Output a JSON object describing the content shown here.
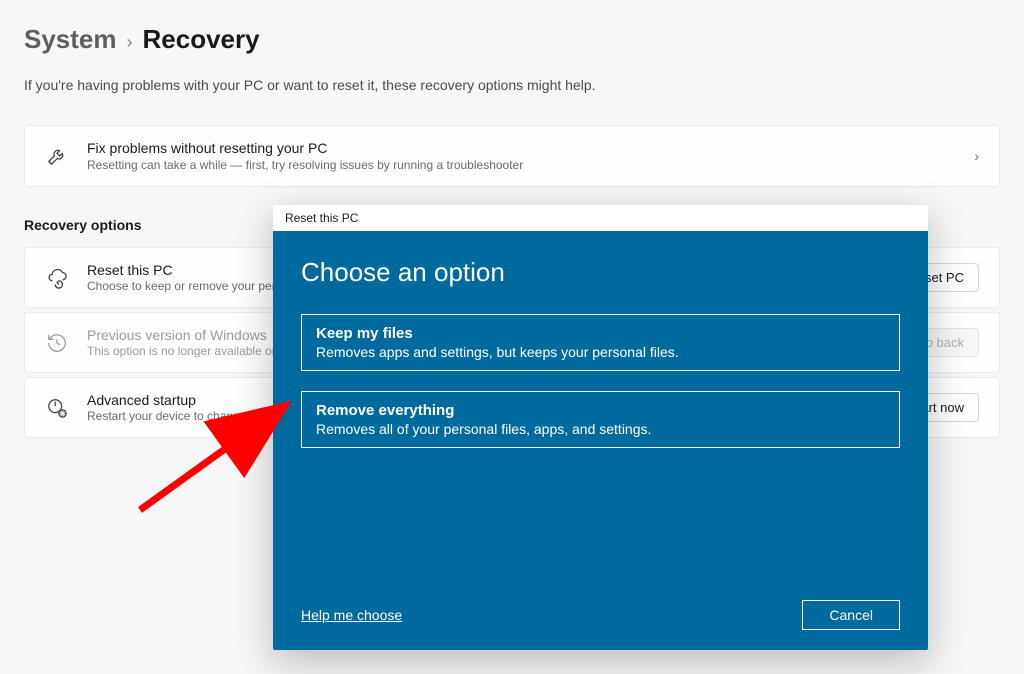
{
  "breadcrumb": {
    "parent": "System",
    "sep": "›",
    "current": "Recovery"
  },
  "subtitle": "If you're having problems with your PC or want to reset it, these recovery options might help.",
  "fix_card": {
    "title": "Fix problems without resetting your PC",
    "desc": "Resetting can take a while — first, try resolving issues by running a troubleshooter"
  },
  "recovery_heading": "Recovery options",
  "options": {
    "reset": {
      "title": "Reset this PC",
      "desc": "Choose to keep or remove your personal files, then reinstall Windows",
      "button": "Reset PC"
    },
    "previous": {
      "title": "Previous version of Windows",
      "desc": "This option is no longer available on this PC",
      "button": "Go back"
    },
    "advanced": {
      "title": "Advanced startup",
      "desc": "Restart your device to change startup settings, including starting from a disc or USB drive",
      "button": "Restart now"
    }
  },
  "dialog": {
    "titlebar": "Reset this PC",
    "heading": "Choose an option",
    "keep": {
      "title": "Keep my files",
      "desc": "Removes apps and settings, but keeps your personal files."
    },
    "remove": {
      "title": "Remove everything",
      "desc": "Removes all of your personal files, apps, and settings."
    },
    "help": "Help me choose",
    "cancel": "Cancel"
  }
}
